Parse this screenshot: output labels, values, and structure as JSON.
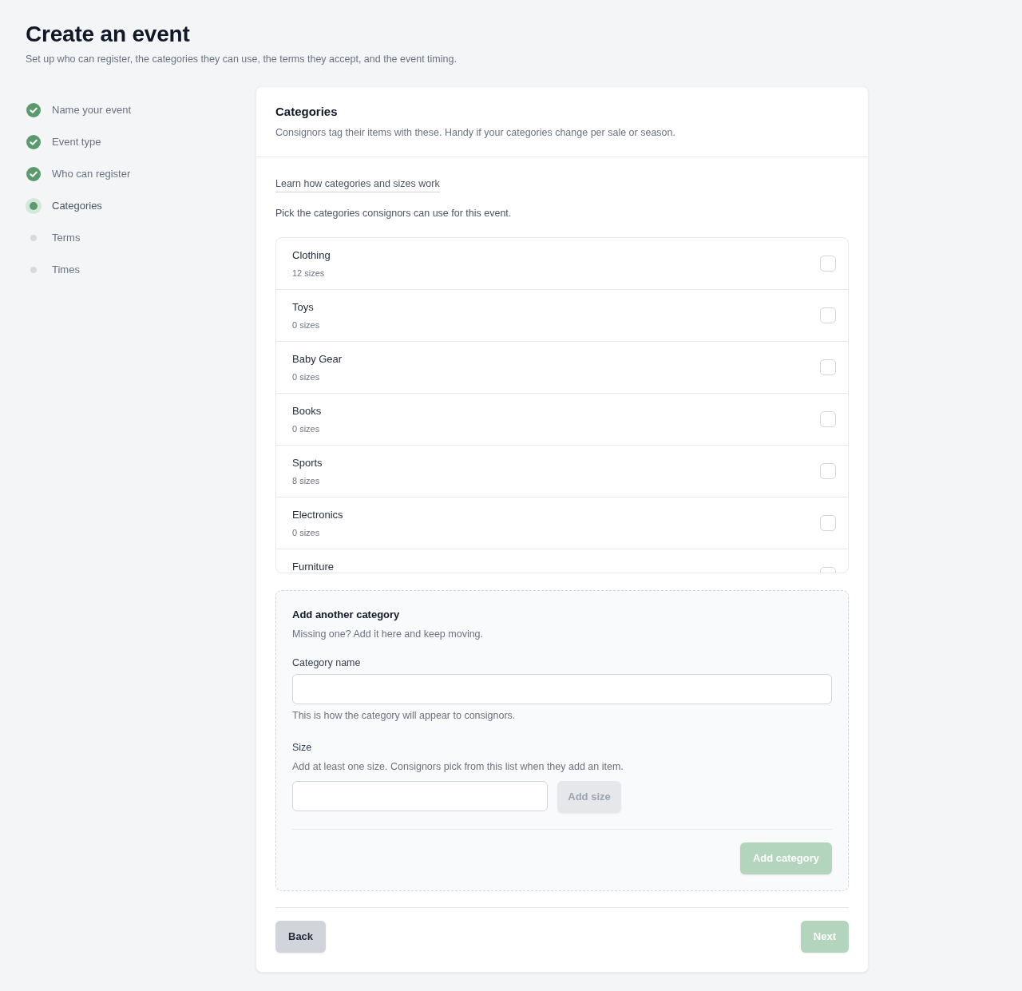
{
  "page": {
    "title": "Create an event",
    "subtitle": "Set up who can register, the categories they can use, the terms they accept, and the event timing."
  },
  "steps": [
    {
      "label": "Name your event",
      "completed": true,
      "selected": false
    },
    {
      "label": "Event type",
      "completed": true,
      "selected": false
    },
    {
      "label": "Who can register",
      "completed": true,
      "selected": false
    },
    {
      "label": "Categories",
      "completed": false,
      "selected": true
    },
    {
      "label": "Terms",
      "completed": false,
      "selected": false
    },
    {
      "label": "Times",
      "completed": false,
      "selected": false
    }
  ],
  "panel": {
    "title": "Categories",
    "description": "Consignors tag their items with these. Handy if your categories change per sale or season.",
    "help_link": "Learn how categories and sizes work",
    "instruction": "Pick the categories consignors can use for this event.",
    "categories": [
      {
        "name": "Clothing",
        "sizes": "12 sizes",
        "checked": false
      },
      {
        "name": "Toys",
        "sizes": "0 sizes",
        "checked": false
      },
      {
        "name": "Baby Gear",
        "sizes": "0 sizes",
        "checked": false
      },
      {
        "name": "Books",
        "sizes": "0 sizes",
        "checked": false
      },
      {
        "name": "Sports",
        "sizes": "8 sizes",
        "checked": false
      },
      {
        "name": "Electronics",
        "sizes": "0 sizes",
        "checked": false
      },
      {
        "name": "Furniture",
        "checked": false
      }
    ]
  },
  "add_category": {
    "title": "Add another category",
    "description": "Missing one? Add it here and keep moving.",
    "name_field": {
      "label": "Category name",
      "hint": "This is how the category will appear to consignors."
    },
    "size_field": {
      "label": "Size",
      "hint": "Add at least one size. Consignors pick from this list when they add an item."
    },
    "add_size_button": {
      "label": "Add size",
      "disabled": true
    },
    "submit_button": {
      "label": "Add category",
      "disabled": true
    }
  },
  "footer": {
    "back_button": {
      "label": "Back",
      "disabled": false
    },
    "next_button": {
      "label": "Next",
      "disabled": true
    }
  }
}
